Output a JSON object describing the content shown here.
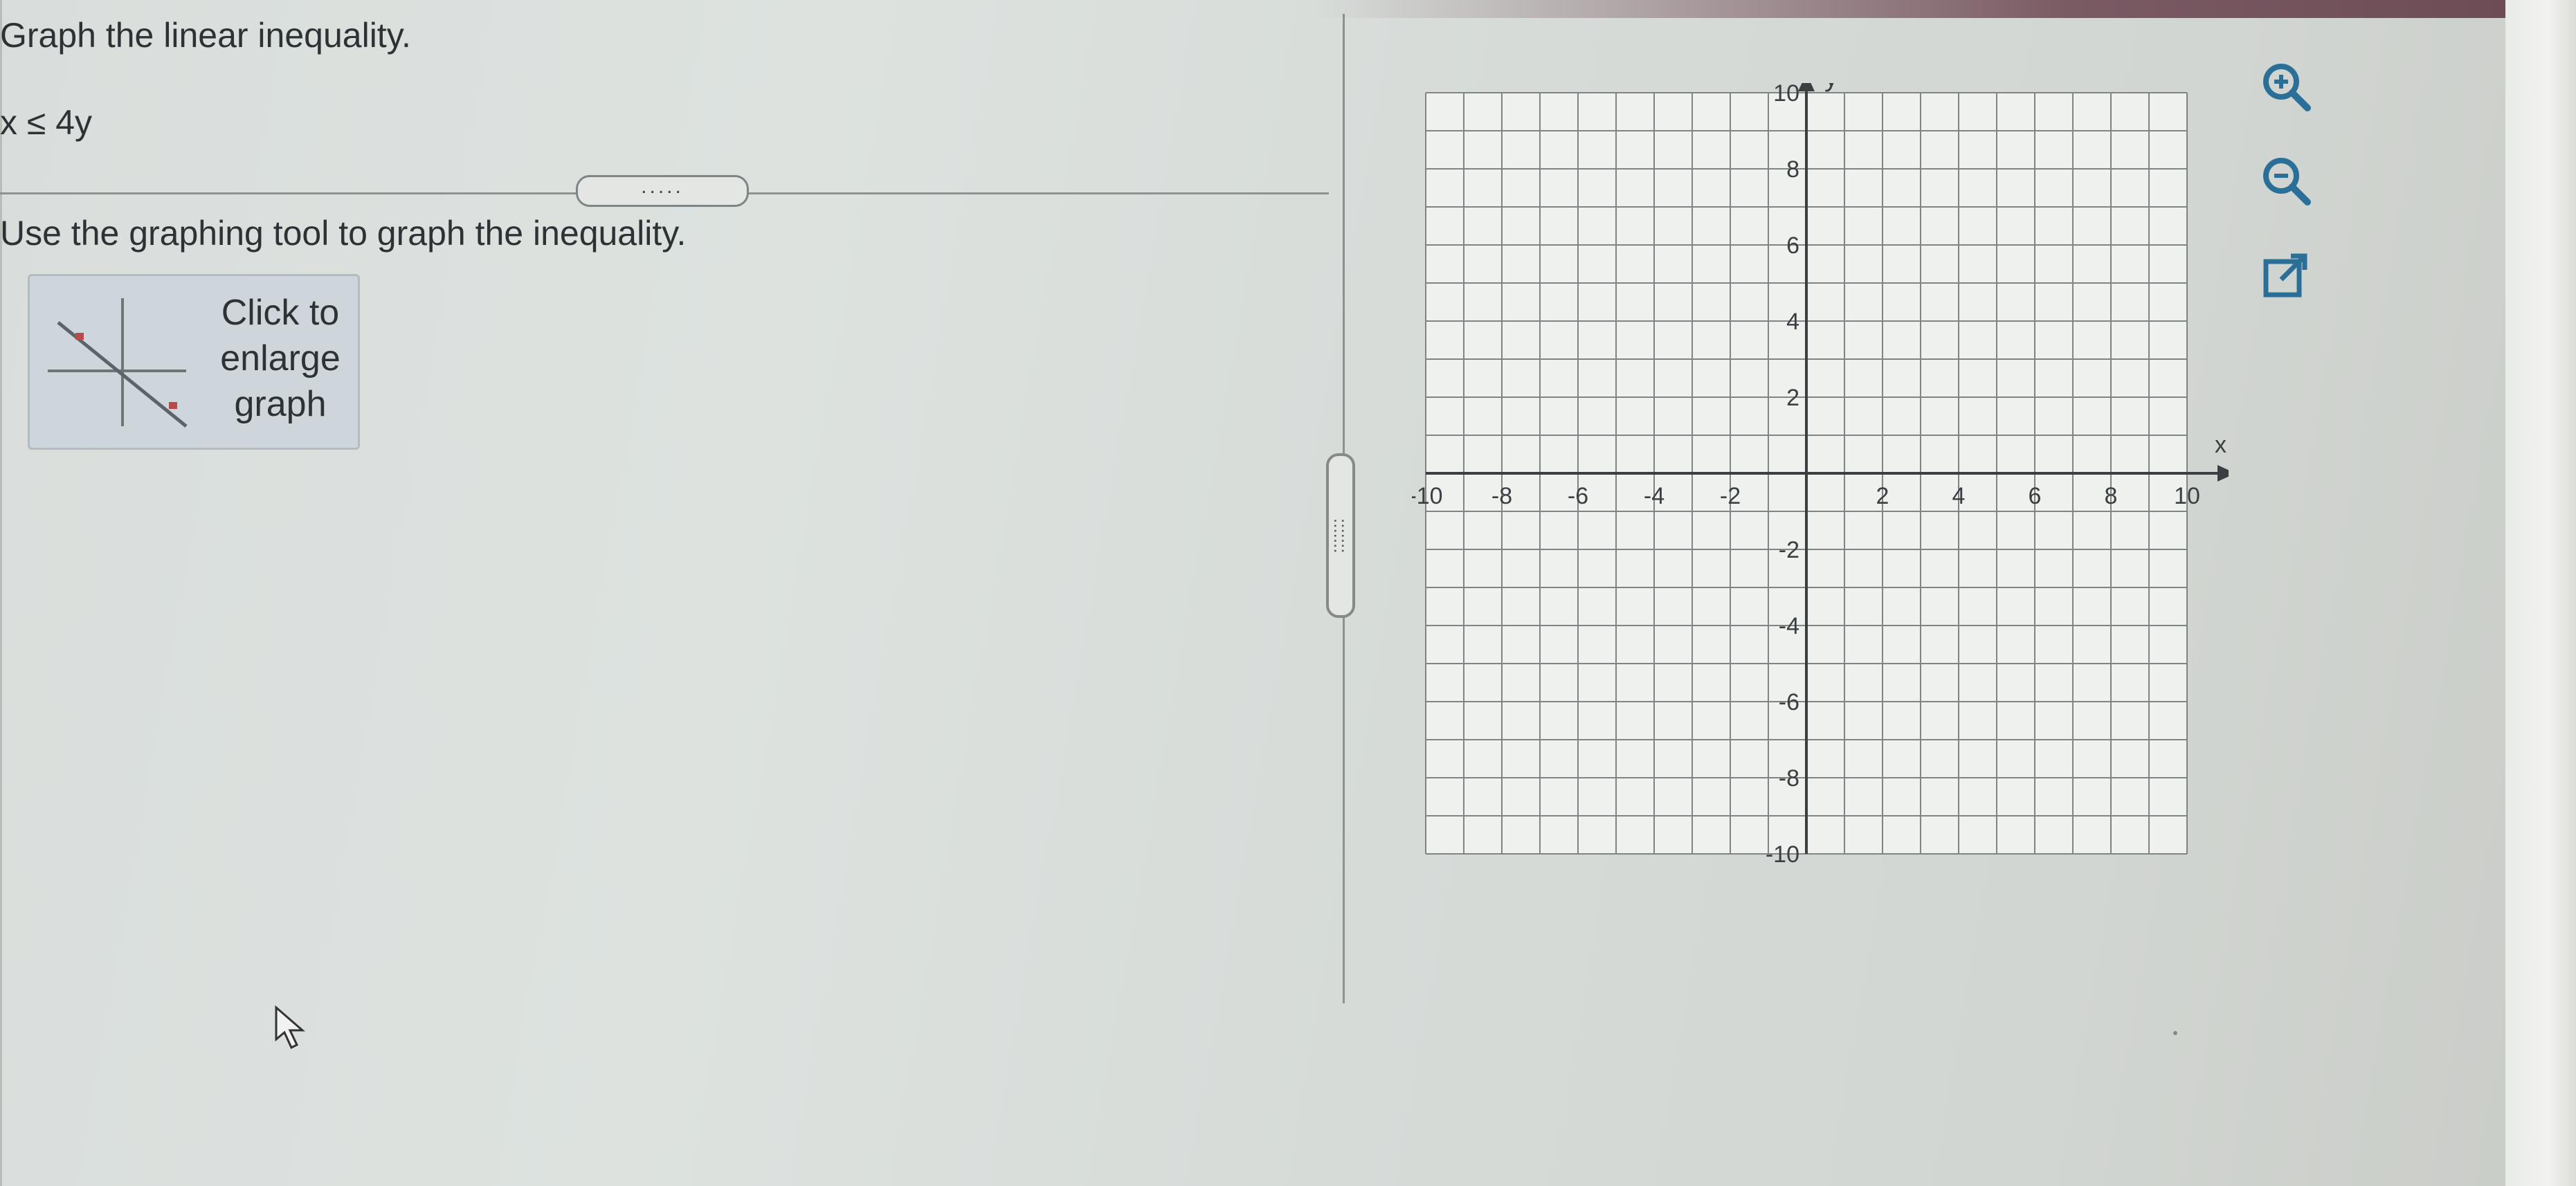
{
  "question": {
    "title": "Graph the linear inequality.",
    "inequality": "x ≤ 4y",
    "instruction": "Use the graphing tool to graph the inequality.",
    "more_indicator": ".....",
    "enlarge_label": "Click to enlarge graph"
  },
  "splitter": {
    "handle_dots": ":::::::"
  },
  "graph": {
    "x_axis_label": "x",
    "y_axis_label": "y",
    "x_tick_labels": [
      "-10",
      "-8",
      "-6",
      "-4",
      "-2",
      "2",
      "4",
      "6",
      "8",
      "10"
    ],
    "y_tick_labels": [
      "10",
      "8",
      "6",
      "4",
      "2",
      "-2",
      "-4",
      "-6",
      "-8",
      "-10"
    ],
    "x_range": [
      -10,
      10
    ],
    "y_range": [
      -10,
      10
    ],
    "grid": true
  },
  "tools": [
    {
      "name": "zoom-in-icon"
    },
    {
      "name": "zoom-out-icon"
    },
    {
      "name": "external-link-icon"
    }
  ],
  "colors": {
    "accent": "#2a6f97",
    "grid": "#7f8485",
    "axis": "#3a3f42"
  }
}
